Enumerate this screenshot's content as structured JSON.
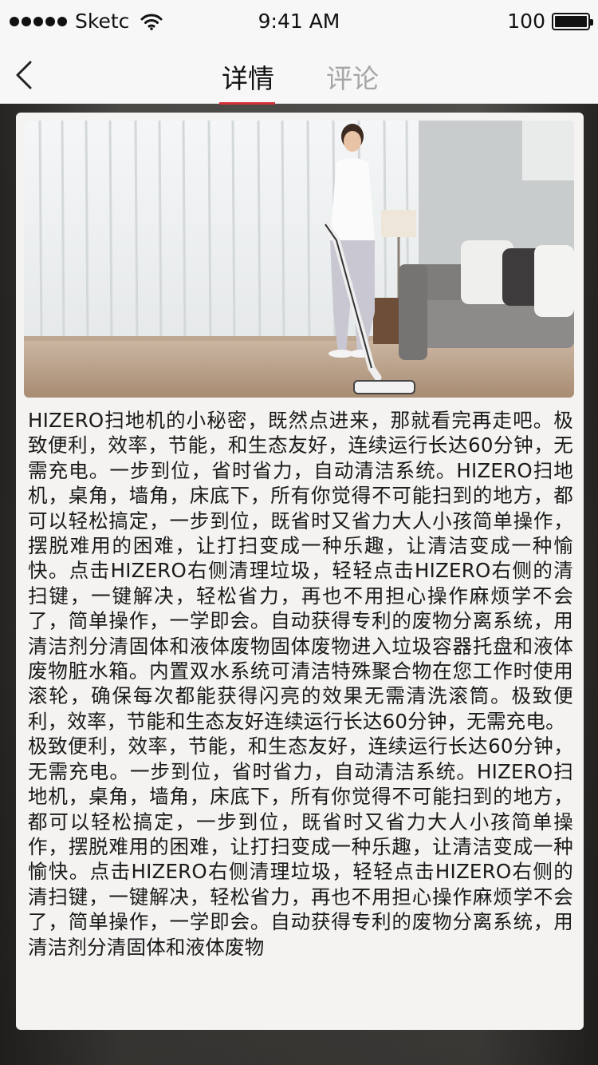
{
  "status_bar": {
    "carrier": "Sketc",
    "time": "9:41 AM",
    "battery": "100",
    "battery_level": 1.0
  },
  "nav": {
    "back_icon": "chevron-left-icon",
    "tabs": [
      {
        "label": "详情",
        "active": true
      },
      {
        "label": "评论",
        "active": false
      }
    ],
    "accent_color": "#d6303a"
  },
  "product_image": {
    "subject": "woman cleaning floor with cordless vacuum in living room"
  },
  "article": {
    "paragraphs": [
      "HIZERO扫地机的小秘密，既然点进来，那就看完再走吧。极致便利，效率，节能，和生态友好，连续运行长达60分钟，无需充电。一步到位，省时省力，自动清洁系统。HIZERO扫地机，桌角，墙角，床底下，所有你觉得不可能扫到的地方，都可以轻松搞定，一步到位，既省时又省力大人小孩简单操作，摆脱难用的困难，让打扫变成一种乐趣，让清洁变成一种愉快。点击HIZERO右侧清理垃圾，轻轻点击HIZERO右侧的清扫键，一键解决，轻松省力，再也不用担心操作麻烦学不会了，简单操作，一学即会。自动获得专利的废物分离系统，用清洁剂分清固体和液体废物固体废物进入垃圾容器托盘和液体废物脏水箱。内置双水系统可清洁特殊聚合物在您工作时使用滚轮，确保每次都能获得闪亮的效果无需清洗滚筒。极致便利，效率，节能和生态友好连续运行长达60分钟，无需充电。",
      "极致便利，效率，节能，和生态友好，连续运行长达60分钟，无需充电。一步到位，省时省力，自动清洁系统。HIZERO扫地机，桌角，墙角，床底下，所有你觉得不可能扫到的地方，都可以轻松搞定，一步到位，既省时又省力大人小孩简单操作，摆脱难用的困难，让打扫变成一种乐趣，让清洁变成一种愉快。点击HIZERO右侧清理垃圾，轻轻点击HIZERO右侧的清扫键，一键解决，轻松省力，再也不用担心操作麻烦学不会了，简单操作，一学即会。自动获得专利的废物分离系统，用清洁剂分清固体和液体废物"
    ]
  }
}
